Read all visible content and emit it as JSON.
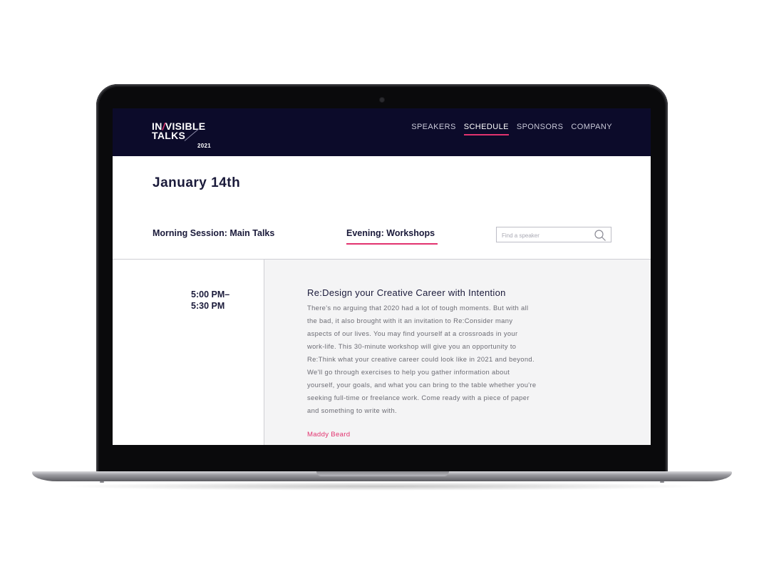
{
  "site": {
    "logo": {
      "line1_a": "IN",
      "line1_slash": "/",
      "line1_b": "VISIBLE",
      "line2": "TALKS",
      "year": "2021"
    },
    "nav": [
      {
        "label": "SPEAKERS",
        "active": false
      },
      {
        "label": "SCHEDULE",
        "active": true
      },
      {
        "label": "SPONSORS",
        "active": false
      },
      {
        "label": "COMPANY",
        "active": false
      }
    ],
    "accent_color": "#e2336f",
    "navbar_color": "#0c0b2a"
  },
  "schedule": {
    "date": "January 14th",
    "tabs": [
      {
        "label": "Morning Session: Main Talks",
        "active": false
      },
      {
        "label": "Evening: Workshops",
        "active": true
      }
    ],
    "search": {
      "placeholder": "Find a speaker",
      "value": "",
      "icon": "search-icon"
    },
    "session": {
      "time_start": "5:00 PM–",
      "time_end": "5:30 PM",
      "title": "Re:Design your Creative Career with Intention",
      "description": "There's no arguing that 2020 had a lot of tough moments. But with all the bad, it also brought with it an invitation to Re:Consider many aspects of our lives. You may find yourself at a crossroads in your work-life. This 30-minute workshop will give you an opportunity to Re:Think what your creative career could look like in 2021 and beyond. We'll go through exercises to help you gather information about yourself, your goals, and what you can bring to the table whether you're seeking full-time or freelance work. Come ready with a piece of paper and something to write with.",
      "speaker": "Maddy Beard"
    }
  }
}
